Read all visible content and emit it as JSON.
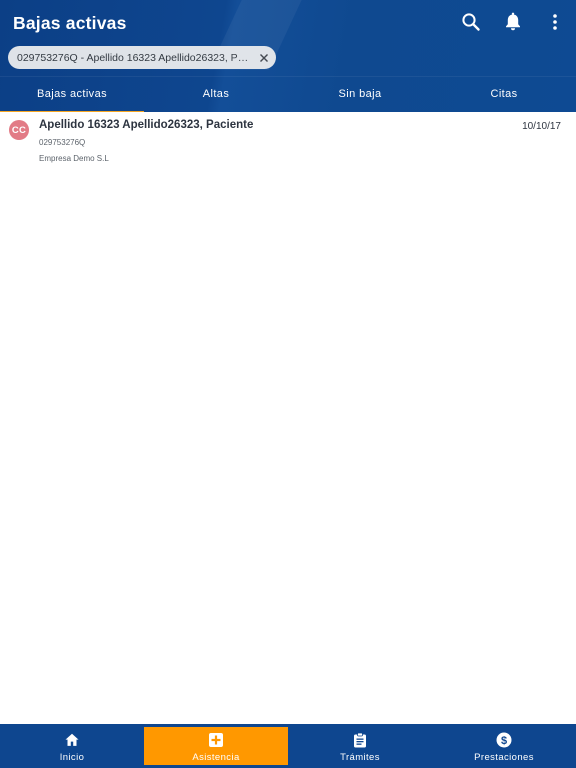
{
  "app": {
    "title": "Bajas activas"
  },
  "header_icons": [
    "search-icon",
    "bell-icon",
    "more-vert-icon"
  ],
  "filter_chip": {
    "label": "029753276Q - Apellido 16323 Apellido26323, Paci..."
  },
  "tabs": [
    {
      "label": "Bajas activas",
      "active": true
    },
    {
      "label": "Altas",
      "active": false
    },
    {
      "label": "Sin baja",
      "active": false
    },
    {
      "label": "Citas",
      "active": false
    }
  ],
  "records": [
    {
      "initials": "CC",
      "name": "Apellido 16323 Apellido26323, Paciente",
      "id": "029753276Q",
      "company": "Empresa Demo S.L",
      "date": "10/10/17"
    }
  ],
  "bottom_nav": [
    {
      "label": "Inicio",
      "icon": "home-icon",
      "active": false
    },
    {
      "label": "Asistencia",
      "icon": "medical-plus-icon",
      "active": true
    },
    {
      "label": "Trámites",
      "icon": "clipboard-icon",
      "active": false
    },
    {
      "label": "Prestaciones",
      "icon": "dollar-circle-icon",
      "active": false
    }
  ],
  "colors": {
    "primary": "#0e468f",
    "tab_indicator": "#f5a623",
    "active_nav": "#ff9800",
    "avatar": "#e27b86"
  }
}
